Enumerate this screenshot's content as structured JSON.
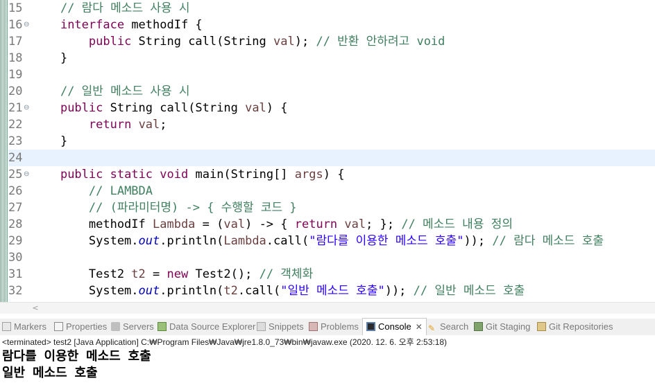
{
  "editor": {
    "lines": [
      {
        "num": "15",
        "fold": "",
        "current": false,
        "tokens": [
          {
            "t": "    ",
            "c": ""
          },
          {
            "t": "// 람다 메소드 사용 시",
            "c": "cm"
          }
        ]
      },
      {
        "num": "16",
        "fold": "⊖",
        "current": false,
        "tokens": [
          {
            "t": "    ",
            "c": ""
          },
          {
            "t": "interface",
            "c": "kw"
          },
          {
            "t": " methodIf {",
            "c": ""
          }
        ]
      },
      {
        "num": "17",
        "fold": "",
        "current": false,
        "tokens": [
          {
            "t": "        ",
            "c": ""
          },
          {
            "t": "public",
            "c": "kw"
          },
          {
            "t": " String call(String ",
            "c": ""
          },
          {
            "t": "val",
            "c": "lv"
          },
          {
            "t": "); ",
            "c": ""
          },
          {
            "t": "// 반환 안하려고 void",
            "c": "cm"
          }
        ]
      },
      {
        "num": "18",
        "fold": "",
        "current": false,
        "tokens": [
          {
            "t": "    }",
            "c": ""
          }
        ]
      },
      {
        "num": "19",
        "fold": "",
        "current": false,
        "tokens": []
      },
      {
        "num": "20",
        "fold": "",
        "current": false,
        "tokens": [
          {
            "t": "    ",
            "c": ""
          },
          {
            "t": "// 일반 메소드 사용 시",
            "c": "cm"
          }
        ]
      },
      {
        "num": "21",
        "fold": "⊖",
        "current": false,
        "tokens": [
          {
            "t": "    ",
            "c": ""
          },
          {
            "t": "public",
            "c": "kw"
          },
          {
            "t": " String call(String ",
            "c": ""
          },
          {
            "t": "val",
            "c": "lv"
          },
          {
            "t": ") {",
            "c": ""
          }
        ]
      },
      {
        "num": "22",
        "fold": "",
        "current": false,
        "tokens": [
          {
            "t": "        ",
            "c": ""
          },
          {
            "t": "return",
            "c": "kw"
          },
          {
            "t": " ",
            "c": ""
          },
          {
            "t": "val",
            "c": "lv"
          },
          {
            "t": ";",
            "c": ""
          }
        ]
      },
      {
        "num": "23",
        "fold": "",
        "current": false,
        "tokens": [
          {
            "t": "    }",
            "c": ""
          }
        ]
      },
      {
        "num": "24",
        "fold": "",
        "current": true,
        "tokens": []
      },
      {
        "num": "25",
        "fold": "⊖",
        "current": false,
        "tokens": [
          {
            "t": "    ",
            "c": ""
          },
          {
            "t": "public",
            "c": "kw"
          },
          {
            "t": " ",
            "c": ""
          },
          {
            "t": "static",
            "c": "kw"
          },
          {
            "t": " ",
            "c": ""
          },
          {
            "t": "void",
            "c": "kw"
          },
          {
            "t": " main(String[] ",
            "c": ""
          },
          {
            "t": "args",
            "c": "lv"
          },
          {
            "t": ") {",
            "c": ""
          }
        ]
      },
      {
        "num": "26",
        "fold": "",
        "current": false,
        "tokens": [
          {
            "t": "        ",
            "c": ""
          },
          {
            "t": "// LAMBDA",
            "c": "cm"
          }
        ]
      },
      {
        "num": "27",
        "fold": "",
        "current": false,
        "tokens": [
          {
            "t": "        ",
            "c": ""
          },
          {
            "t": "// (파라미터명) -> { 수행할 코드 }",
            "c": "cm"
          }
        ]
      },
      {
        "num": "28",
        "fold": "",
        "current": false,
        "tokens": [
          {
            "t": "        methodIf ",
            "c": ""
          },
          {
            "t": "Lambda",
            "c": "lv"
          },
          {
            "t": " = (",
            "c": ""
          },
          {
            "t": "val",
            "c": "lv"
          },
          {
            "t": ") -> { ",
            "c": ""
          },
          {
            "t": "return",
            "c": "kw"
          },
          {
            "t": " ",
            "c": ""
          },
          {
            "t": "val",
            "c": "lv"
          },
          {
            "t": "; }; ",
            "c": ""
          },
          {
            "t": "// 메소드 내용 정의",
            "c": "cm"
          }
        ]
      },
      {
        "num": "29",
        "fold": "",
        "current": false,
        "tokens": [
          {
            "t": "        System.",
            "c": ""
          },
          {
            "t": "out",
            "c": "st-it"
          },
          {
            "t": ".println(",
            "c": ""
          },
          {
            "t": "Lambda",
            "c": "lv"
          },
          {
            "t": ".call(",
            "c": ""
          },
          {
            "t": "\"람다를 이용한 메소드 호출\"",
            "c": "st"
          },
          {
            "t": ")); ",
            "c": ""
          },
          {
            "t": "// 람다 메소드 호출",
            "c": "cm"
          }
        ]
      },
      {
        "num": "30",
        "fold": "",
        "current": false,
        "tokens": []
      },
      {
        "num": "31",
        "fold": "",
        "current": false,
        "tokens": [
          {
            "t": "        Test2 ",
            "c": ""
          },
          {
            "t": "t2",
            "c": "lv"
          },
          {
            "t": " = ",
            "c": ""
          },
          {
            "t": "new",
            "c": "kw"
          },
          {
            "t": " Test2(); ",
            "c": ""
          },
          {
            "t": "// 객체화",
            "c": "cm"
          }
        ]
      },
      {
        "num": "32",
        "fold": "",
        "current": false,
        "tokens": [
          {
            "t": "        System.",
            "c": ""
          },
          {
            "t": "out",
            "c": "st-it"
          },
          {
            "t": ".println(",
            "c": ""
          },
          {
            "t": "t2",
            "c": "lv"
          },
          {
            "t": ".call(",
            "c": ""
          },
          {
            "t": "\"일반 메소드 호출\"",
            "c": "st"
          },
          {
            "t": ")); ",
            "c": ""
          },
          {
            "t": "// 일반 메소드 호출",
            "c": "cm"
          }
        ]
      }
    ]
  },
  "scrollbar": {
    "left_arrow": "<"
  },
  "tabs": [
    {
      "id": "markers",
      "label": "Markers",
      "icon": "markers-icon",
      "active": false
    },
    {
      "id": "properties",
      "label": "Properties",
      "icon": "properties-icon",
      "active": false
    },
    {
      "id": "servers",
      "label": "Servers",
      "icon": "servers-icon",
      "active": false
    },
    {
      "id": "data-source-explorer",
      "label": "Data Source Explorer",
      "icon": "data-source-icon",
      "active": false
    },
    {
      "id": "snippets",
      "label": "Snippets",
      "icon": "snippets-icon",
      "active": false
    },
    {
      "id": "problems",
      "label": "Problems",
      "icon": "problems-icon",
      "active": false
    },
    {
      "id": "console",
      "label": "Console",
      "icon": "console-icon",
      "active": true,
      "close": "✕"
    },
    {
      "id": "search",
      "label": "Search",
      "icon": "search-icon",
      "active": false
    },
    {
      "id": "git-staging",
      "label": "Git Staging",
      "icon": "git-staging-icon",
      "active": false
    },
    {
      "id": "git-repositories",
      "label": "Git Repositories",
      "icon": "git-repositories-icon",
      "active": false
    }
  ],
  "console": {
    "status": "<terminated> test2 [Java Application] C:₩Program Files₩Java₩jre1.8.0_73₩bin₩javaw.exe (2020. 12. 6. 오후 2:53:18)",
    "output": [
      "람다를 이용한 메소드 호출",
      "일반 메소드 호출"
    ]
  },
  "colors": {
    "keyword": "#7f0055",
    "comment": "#3f7f5f",
    "string": "#2a00ff",
    "static_field": "#0000c0",
    "local_variable": "#6a3e3e",
    "current_line": "#e8f2fe"
  }
}
